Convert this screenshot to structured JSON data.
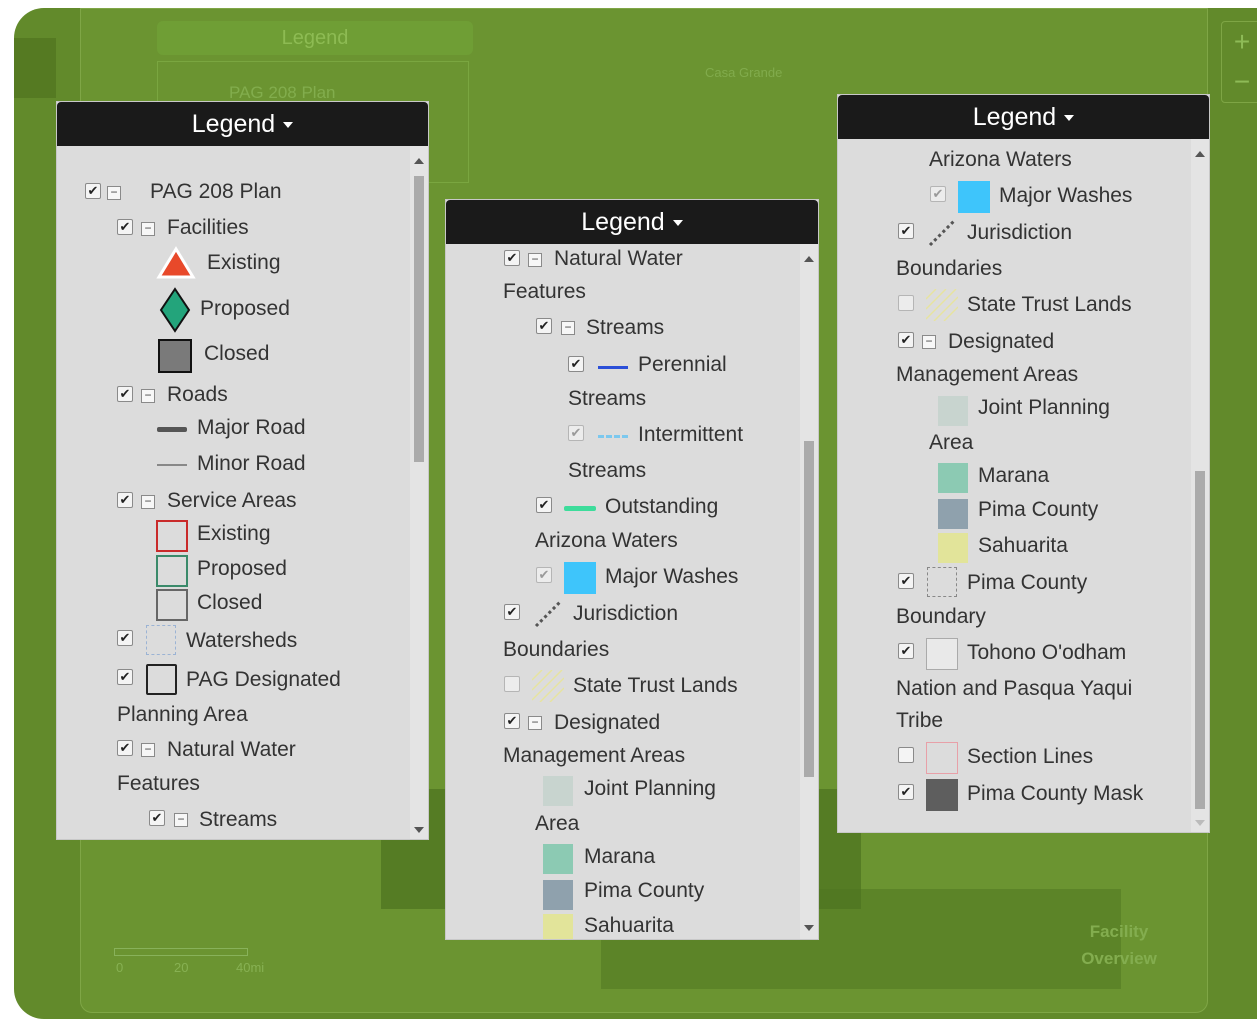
{
  "background_map": {
    "legend_button": "Legend",
    "legend_item": "PAG 208 Plan",
    "city_label": "Casa Grande",
    "zoom_in": "+",
    "zoom_out": "−",
    "scale_labels": [
      "0",
      "20",
      "40mi"
    ],
    "overview_label": "Facility Overview"
  },
  "panels": [
    {
      "title": "Legend",
      "items": [
        {
          "label": "PAG 208 Plan",
          "checked": true,
          "collapsible": true
        },
        {
          "label": "Facilities",
          "checked": true,
          "collapsible": true
        },
        {
          "label": "Existing",
          "symbol": "red-triangle"
        },
        {
          "label": "Proposed",
          "symbol": "green-diamond"
        },
        {
          "label": "Closed",
          "symbol": "gray-square"
        },
        {
          "label": "Roads",
          "checked": true,
          "collapsible": true
        },
        {
          "label": "Major Road",
          "symbol": "thick-line"
        },
        {
          "label": "Minor Road",
          "symbol": "thin-line"
        },
        {
          "label": "Service Areas",
          "checked": true,
          "collapsible": true
        },
        {
          "label": "Existing",
          "symbol": "red-outline-box"
        },
        {
          "label": "Proposed",
          "symbol": "green-outline-box"
        },
        {
          "label": "Closed",
          "symbol": "gray-outline-box"
        },
        {
          "label": "Watersheds",
          "checked": true,
          "symbol": "dashed-box"
        },
        {
          "label": "PAG Designated",
          "label2": "Planning Area",
          "checked": true,
          "symbol": "black-outline-box"
        },
        {
          "label": "Natural Water",
          "label2": "Features",
          "checked": true,
          "collapsible": true
        },
        {
          "label": "Streams",
          "checked": true,
          "collapsible": true
        }
      ]
    },
    {
      "title": "Legend",
      "items": [
        {
          "label": "Natural Water",
          "label2": "Features",
          "checked": true,
          "collapsible": true
        },
        {
          "label": "Streams",
          "checked": true,
          "collapsible": true
        },
        {
          "label": "Perennial",
          "label2": "Streams",
          "checked": true,
          "symbol": "blue-line"
        },
        {
          "label": "Intermittent",
          "label2": "Streams",
          "checked": true,
          "dim": true,
          "symbol": "dashed-cyan-line"
        },
        {
          "label": "Outstanding",
          "label2": "Arizona Waters",
          "checked": true,
          "symbol": "green-line"
        },
        {
          "label": "Major Washes",
          "checked": true,
          "dim": true,
          "symbol": "cyan-box"
        },
        {
          "label": "Jurisdiction",
          "label2": "Boundaries",
          "checked": true,
          "symbol": "dotted-diagonal"
        },
        {
          "label": "State Trust Lands",
          "checked": false,
          "symbol": "hatch-box"
        },
        {
          "label": "Designated",
          "label2": "Management Areas",
          "checked": true,
          "collapsible": true
        },
        {
          "label": "Joint Planning",
          "label2": "Area",
          "symbol": "pale-gray-box"
        },
        {
          "label": "Marana",
          "symbol": "teal-box"
        },
        {
          "label": "Pima County",
          "symbol": "slate-box"
        },
        {
          "label": "Sahuarita",
          "symbol": "yellow-box"
        }
      ]
    },
    {
      "title": "Legend",
      "items": [
        {
          "label": "Arizona Waters"
        },
        {
          "label": "Major Washes",
          "checked": true,
          "dim": true,
          "symbol": "cyan-box"
        },
        {
          "label": "Jurisdiction",
          "label2": "Boundaries",
          "checked": true,
          "symbol": "dotted-diagonal"
        },
        {
          "label": "State Trust Lands",
          "checked": false,
          "symbol": "hatch-box"
        },
        {
          "label": "Designated",
          "label2": "Management Areas",
          "checked": true,
          "collapsible": true
        },
        {
          "label": "Joint Planning",
          "label2": "Area",
          "symbol": "pale-gray-box"
        },
        {
          "label": "Marana",
          "symbol": "teal-box"
        },
        {
          "label": "Pima County",
          "symbol": "slate-box"
        },
        {
          "label": "Sahuarita",
          "symbol": "yellow-box"
        },
        {
          "label": "Pima County",
          "label2": "Boundary",
          "checked": true,
          "symbol": "dashed-square"
        },
        {
          "label": "Tohono O'odham",
          "label2": "Nation and Pasqua Yaqui",
          "label3": "Tribe",
          "checked": true,
          "symbol": "white-box"
        },
        {
          "label": "Section Lines",
          "checked": false,
          "symbol": "pink-outline-box"
        },
        {
          "label": "Pima County Mask",
          "checked": true,
          "symbol": "dark-gray-box"
        }
      ]
    }
  ],
  "colors": {
    "map_background": "#628a2b",
    "panel_header": "#1a1a1a",
    "panel_body": "#dcdcdc"
  }
}
